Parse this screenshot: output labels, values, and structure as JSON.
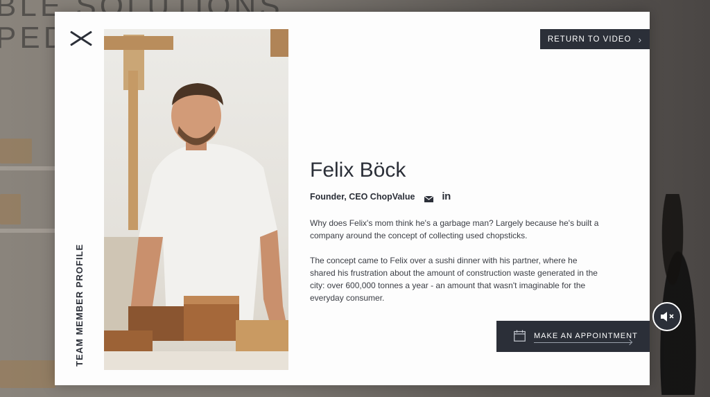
{
  "background": {
    "headline_lines": [
      "BLE SOLUTIONS",
      "PED T"
    ]
  },
  "modal": {
    "close_icon": "close-x-icon",
    "vertical_label": "TEAM MEMBER PROFILE",
    "return_button": {
      "label": "RETURN TO VIDEO",
      "icon": "chevron-right-icon"
    },
    "profile": {
      "name": "Felix Böck",
      "role": "Founder, CEO ChopValue",
      "email_icon": "envelope-icon",
      "linkedin_label": "in",
      "bio": [
        "Why does Felix's mom think he's a garbage man? Largely because he's built a company around the concept of collecting used chopsticks.",
        "The concept came to Felix over a sushi dinner with his partner, where he shared his frustration about the amount of construction waste generated in the city: over 600,000 tonnes a year - an amount that wasn't imaginable for the everyday consumer."
      ]
    },
    "appointment_button": {
      "label": "MAKE AN APPOINTMENT",
      "icon": "calendar-icon"
    }
  },
  "mute_button": {
    "icon": "speaker-muted-icon"
  },
  "colors": {
    "dark": "#2b2f38",
    "modal_bg": "#fdfdfd"
  }
}
